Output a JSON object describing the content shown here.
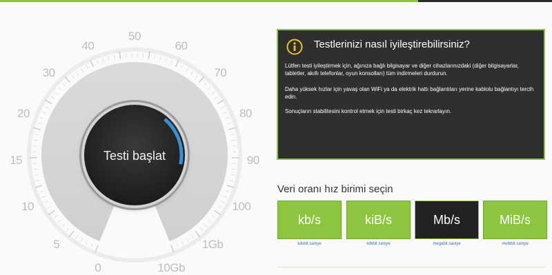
{
  "gauge": {
    "scale_labels": [
      "0",
      "5",
      "10",
      "15",
      "20",
      "30",
      "40",
      "50",
      "60",
      "70",
      "80",
      "90",
      "100",
      "1Gb",
      "10Gb"
    ],
    "start_label": "Testi başlat",
    "progress_fraction": 0.17
  },
  "tips": {
    "title": "Testlerinizi nasıl iyileştirebilirsiniz?",
    "paragraphs": [
      "Lütfen testi iyileştirmek için, ağınıza bağlı bilgisayar ve diğer cihazlarınızdaki (diğer bilgisayarlar, tabletler, akıllı telefonlar, oyun konsolları) tüm indirmeleri durdurun.",
      "Daha yüksek hızlar için yavaş olan WiFi ya da elektrik hattı bağlantıları yerine kablolu bağlantıyı tercih edin.",
      "Sonuçların stabilitesini kontrol etmek için testi birkaç kez tekrarlayın."
    ]
  },
  "units": {
    "title": "Veri oranı hız birimi seçin",
    "options": [
      {
        "label": "kb/s",
        "caption": "kilobit saniye",
        "selected": false
      },
      {
        "label": "kiB/s",
        "caption": "kibibit saniye",
        "selected": false
      },
      {
        "label": "Mb/s",
        "caption": "megabit saniye",
        "selected": true
      },
      {
        "label": "MiB/s",
        "caption": "mebibit saniye",
        "selected": false
      }
    ]
  },
  "colors": {
    "accent": "#8cc63f",
    "panel": "#2f2f2f",
    "progress": "#3a8fd0",
    "caption_link": "#3a6bc4"
  }
}
